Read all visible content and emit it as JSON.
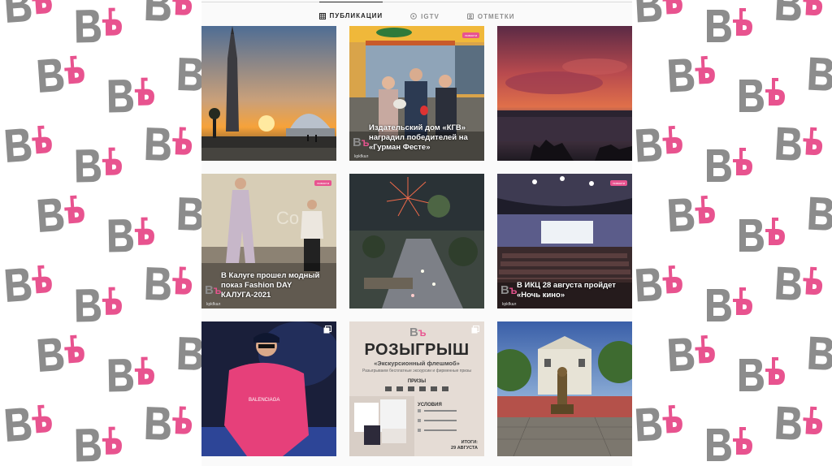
{
  "tabs": [
    {
      "label": "ПУБЛИКАЦИИ",
      "icon": "grid-icon",
      "active": true
    },
    {
      "label": "IGTV",
      "icon": "igtv-icon",
      "active": false
    },
    {
      "label": "ОТМЕТКИ",
      "icon": "tagged-icon",
      "active": false
    }
  ],
  "brand": {
    "logo_text": "ВЪ",
    "handle": "kpkfkaл",
    "accent": "#e8538f",
    "gray": "#8c8c8c"
  },
  "posts": [
    {
      "kind": "photo",
      "scene": "rocket-sunset",
      "caption": ""
    },
    {
      "kind": "photo",
      "scene": "award-people",
      "caption": "Издательский дом «КГВ» наградил победителей на «Гурман Фесте»",
      "badge": "новости"
    },
    {
      "kind": "photo",
      "scene": "purple-sky",
      "caption": ""
    },
    {
      "kind": "photo",
      "scene": "fashion-show",
      "caption": "В Калуге прошел модный показ Fashion DAY КАЛУГА-2021",
      "badge": "новости"
    },
    {
      "kind": "photo",
      "scene": "fireworks",
      "caption": ""
    },
    {
      "kind": "photo",
      "scene": "cinema-hall",
      "caption": "В ИКЦ 28 августа пройдет «Ночь кино»",
      "badge": "новости"
    },
    {
      "kind": "photo",
      "scene": "singer",
      "caption": ""
    },
    {
      "kind": "raffle",
      "title": "РОЗЫГРЫШ",
      "subtitle": "«Экскурсионный флешмоб»",
      "small": "Разыгрываем бесплатные экскурсии и фирменные призы",
      "prizes_label": "ПРИЗЫ",
      "conditions_label": "УСЛОВИЯ",
      "results_label": "ИТОГИ:",
      "results_date": "29 АВГУСТА"
    },
    {
      "kind": "photo",
      "scene": "monument",
      "caption": ""
    }
  ]
}
